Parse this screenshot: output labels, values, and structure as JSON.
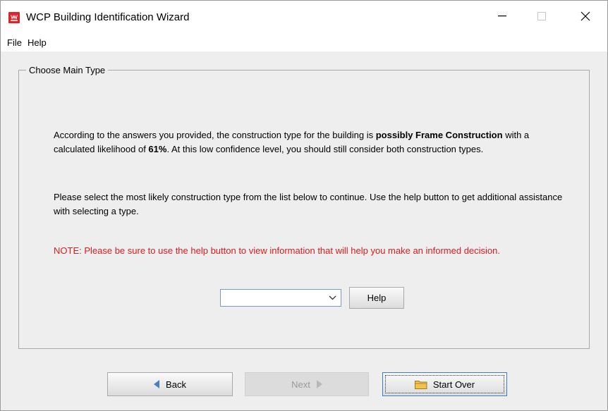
{
  "window": {
    "title": "WCP Building Identification Wizard",
    "icon": "wcp-app-icon",
    "controls": {
      "minimize": "minimize-icon",
      "maximize": "maximize-icon",
      "close": "close-icon"
    }
  },
  "menu": {
    "file": "File",
    "help": "Help"
  },
  "group": {
    "title": "Choose Main Type"
  },
  "content": {
    "p1_a": "According to the answers you provided, the construction type for the building is ",
    "p1_b": "possibly Frame Construction",
    "p1_c": " with a calculated likelihood of ",
    "p1_d": "61%",
    "p1_e": ". At this low confidence level, you should still consider both construction types.",
    "p2": "Please select the most likely construction type from the list below to continue. Use the help button to get additional assistance with selecting a type.",
    "note": "NOTE: Please be sure to use the help button to view information that will help you make an informed decision."
  },
  "type_select": {
    "value": ""
  },
  "buttons": {
    "help": "Help",
    "back": "Back",
    "next": "Next",
    "start_over": "Start Over"
  },
  "colors": {
    "note": "#e0191c",
    "app_icon": "#d9252b",
    "focus_border": "#3c7fc8"
  }
}
